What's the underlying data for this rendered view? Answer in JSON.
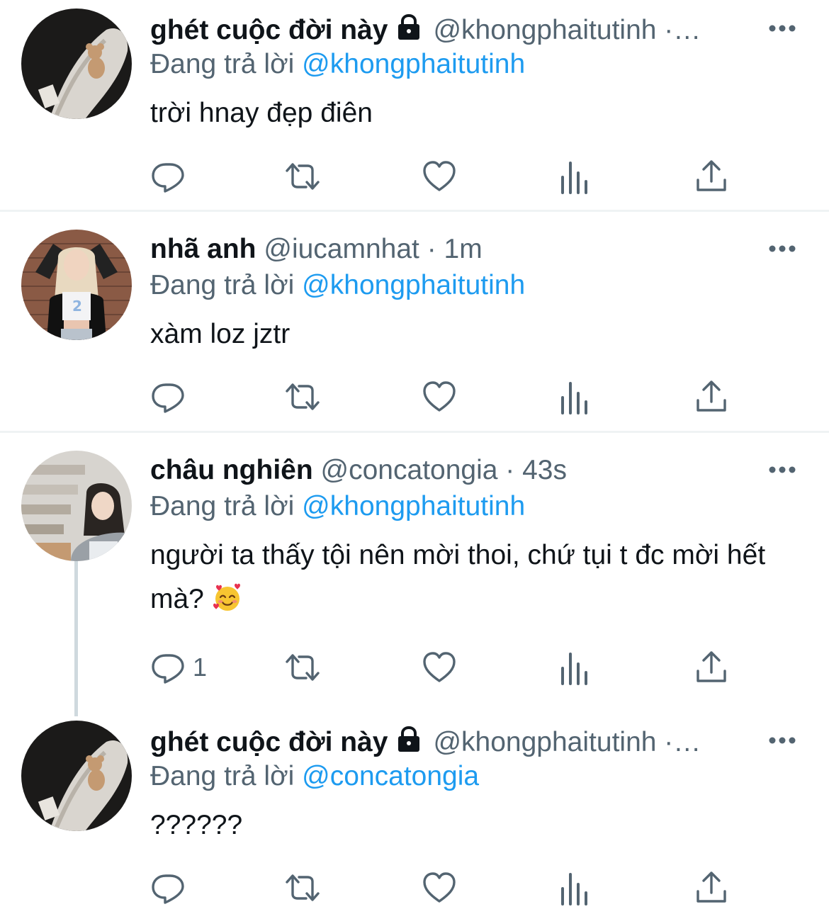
{
  "colors": {
    "text_primary": "#0f1419",
    "text_secondary": "#536471",
    "accent": "#1d9bf0",
    "divider": "#eff3f4",
    "thread_line": "#cfd9de"
  },
  "tweets": [
    {
      "display_name": "ghét cuộc đời này",
      "locked": true,
      "handle_time": "@khongphaitutinh ·…",
      "reply_prefix": "Đang trả lời",
      "reply_to": "@khongphaitutinh",
      "text": "trời hnay đẹp điên",
      "reply_count": ""
    },
    {
      "display_name": "nhã anh",
      "locked": false,
      "handle_time": "@iucamnhat · 1m",
      "reply_prefix": "Đang trả lời",
      "reply_to": "@khongphaitutinh",
      "text": "xàm loz jztr",
      "reply_count": ""
    },
    {
      "display_name": "châu nghiên",
      "locked": false,
      "handle_time": "@concatongia · 43s",
      "reply_prefix": "Đang trả lời",
      "reply_to": "@khongphaitutinh",
      "text": "người ta thấy tội nên mời thoi, chứ tụi t đc mời hết mà?",
      "emoji": "🥰",
      "reply_count": "1"
    },
    {
      "display_name": "ghét cuộc đời này",
      "locked": true,
      "handle_time": "@khongphaitutinh ·…",
      "reply_prefix": "Đang trả lời",
      "reply_to": "@concatongia",
      "text": "??????",
      "reply_count": ""
    }
  ]
}
